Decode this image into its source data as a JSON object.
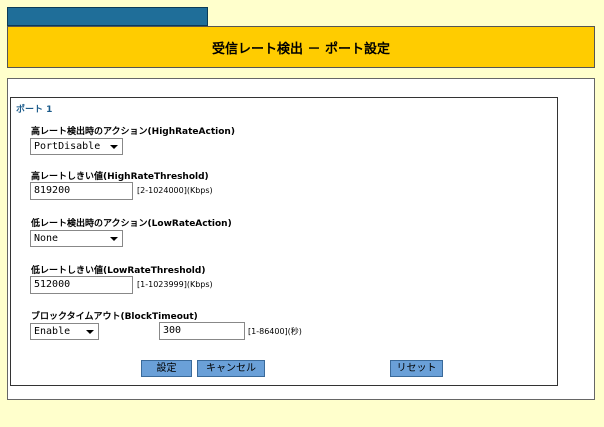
{
  "header": {
    "title": "受信レート検出 － ポート設定"
  },
  "port": {
    "title": "ポート 1",
    "high_action": {
      "label": "高レート検出時のアクション(HighRateAction)",
      "value": "PortDisable"
    },
    "high_threshold": {
      "label": "高レートしきい値(HighRateThreshold)",
      "value": "819200",
      "hint": "[2-1024000](Kbps)"
    },
    "low_action": {
      "label": "低レート検出時のアクション(LowRateAction)",
      "value": "None"
    },
    "low_threshold": {
      "label": "低レートしきい値(LowRateThreshold)",
      "value": "512000",
      "hint": "[1-1023999](Kbps)"
    },
    "block_timeout": {
      "label": "ブロックタイムアウト(BlockTimeout)",
      "select_value": "Enable",
      "value": "300",
      "hint": "[1-86400](秒)"
    }
  },
  "buttons": {
    "apply": "設定",
    "cancel": "キャンセル",
    "reset": "リセット"
  },
  "colors": {
    "title_bar": "#ffcc00",
    "tab": "#1f6e99",
    "button": "#6aa0d8",
    "background": "#ffffcc"
  }
}
